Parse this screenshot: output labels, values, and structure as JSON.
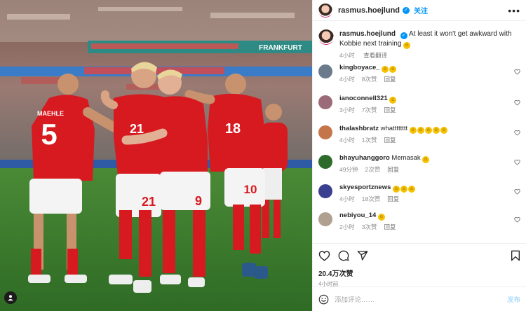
{
  "post": {
    "username": "rasmus.hoejlund",
    "follow_label": "关注",
    "more_label": "•••",
    "caption_text": "At least it won't get awkward with Kobbie next training",
    "caption_time": "4小时",
    "translate_label": "查看翻译",
    "likes": "20.4万次赞",
    "posted_ago": "4小时前",
    "comment_placeholder": "添加评论……",
    "post_label": "发布"
  },
  "photo": {
    "banner_text": "FRANKFURT",
    "shirt_numbers": [
      "5",
      "21",
      "9",
      "18",
      "10"
    ],
    "nameplate": "MAEHLE"
  },
  "comments": [
    {
      "user": "kingboyace_",
      "text": "",
      "emoji_count": 2,
      "time": "4小时",
      "likes": "8次赞",
      "reply": "回复",
      "avatar_color": "#6b7b8c"
    },
    {
      "user": "ianoconnell321",
      "text": "",
      "emoji_count": 1,
      "time": "3小时",
      "likes": "7次赞",
      "reply": "回复",
      "avatar_color": "#9c6b7a"
    },
    {
      "user": "thalashbratz",
      "text": "whatttttttt",
      "emoji_count": 5,
      "time": "4小时",
      "likes": "1次赞",
      "reply": "回复",
      "avatar_color": "#c4764a"
    },
    {
      "user": "bhayuhanggoro",
      "text": "Memasak",
      "emoji_count": 1,
      "time": "49分钟",
      "likes": "2次赞",
      "reply": "回复",
      "avatar_color": "#2e6b2a"
    },
    {
      "user": "skyesportznews",
      "text": "",
      "emoji_count": 3,
      "time": "4小时",
      "likes": "18次赞",
      "reply": "回复",
      "avatar_color": "#3a3f8f"
    },
    {
      "user": "nebiyou_14",
      "text": "",
      "emoji_count": 1,
      "time": "2小时",
      "likes": "3次赞",
      "reply": "回复",
      "avatar_color": "#b0a090"
    }
  ],
  "colors": {
    "accent": "#0095f6",
    "text": "#262626",
    "muted": "#8e8e8e",
    "kit_red": "#d71920",
    "pitch": "#3c7a2e"
  },
  "icons": [
    "more-icon",
    "verified-icon",
    "heart-icon",
    "comment-icon",
    "share-icon",
    "bookmark-icon",
    "emoji-icon",
    "user-tag-icon"
  ]
}
